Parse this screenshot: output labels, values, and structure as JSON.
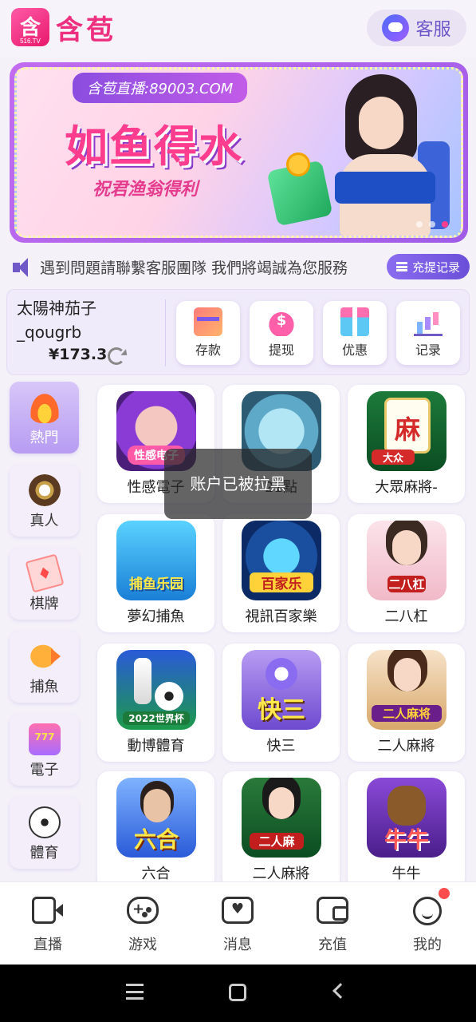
{
  "header": {
    "logo_glyph": "含",
    "logo_sub": "516.TV",
    "brand": "含苞",
    "service_label": "客服"
  },
  "banner": {
    "tag": "含苞直播:89003.COM",
    "title": "如鱼得水",
    "subtitle": "祝君渔翁得利",
    "slides": 3,
    "active_slide": 3
  },
  "notice": {
    "text": "遇到問題請聯繫客服團隊 我們將竭誠為您服務",
    "record_label": "充提记录"
  },
  "account": {
    "name_line1": "太陽神茄子",
    "name_line2": "_qougrb",
    "balance": "¥173.3",
    "actions": [
      {
        "label": "存款",
        "icon": "deposit-icon"
      },
      {
        "label": "提现",
        "icon": "withdraw-icon"
      },
      {
        "label": "优惠",
        "icon": "gift-icon"
      },
      {
        "label": "记录",
        "icon": "record-icon"
      }
    ]
  },
  "categories": [
    {
      "label": "熱門",
      "icon": "fire-icon",
      "active": true
    },
    {
      "label": "真人",
      "icon": "casino-chip-icon"
    },
    {
      "label": "棋牌",
      "icon": "playing-card-icon"
    },
    {
      "label": "捕魚",
      "icon": "fish-icon"
    },
    {
      "label": "電子",
      "icon": "slot-icon"
    },
    {
      "label": "體育",
      "icon": "soccer-ball-icon"
    }
  ],
  "games": [
    {
      "name": "性感電子",
      "badge": "性感电子"
    },
    {
      "name": "21點",
      "badge": ""
    },
    {
      "name": "大眾麻將-",
      "badge": "大众"
    },
    {
      "name": "夢幻捕魚",
      "badge": "捕鱼乐园"
    },
    {
      "name": "視訊百家樂",
      "badge": "百家乐"
    },
    {
      "name": "二八杠",
      "badge": "二八杠"
    },
    {
      "name": "動博體育",
      "badge": "2022世界杯"
    },
    {
      "name": "快三",
      "badge": "快三"
    },
    {
      "name": "二人麻將",
      "badge": "二人麻将"
    },
    {
      "name": "六合",
      "badge": "六合"
    },
    {
      "name": "二人麻將",
      "badge": "二人麻"
    },
    {
      "name": "牛牛",
      "badge": "牛牛"
    }
  ],
  "toast": "账户已被拉黑",
  "bottom_nav": [
    {
      "label": "直播",
      "icon": "live-camera-icon"
    },
    {
      "label": "游戏",
      "icon": "gamepad-icon"
    },
    {
      "label": "消息",
      "icon": "message-icon"
    },
    {
      "label": "充值",
      "icon": "wallet-icon"
    },
    {
      "label": "我的",
      "icon": "profile-icon"
    }
  ]
}
